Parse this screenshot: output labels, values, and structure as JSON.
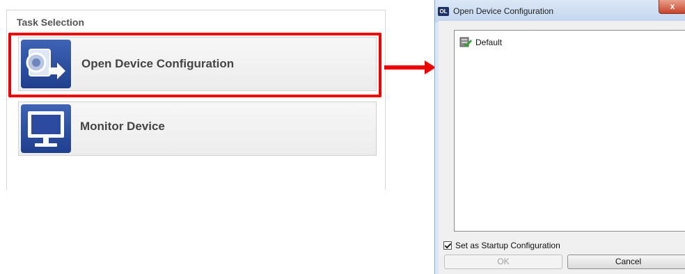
{
  "task_panel": {
    "title": "Task Selection",
    "items": [
      {
        "label": "Open Device Configuration",
        "icon": "device-config-icon"
      },
      {
        "label": "Monitor Device",
        "icon": "monitor-icon"
      }
    ]
  },
  "dialog": {
    "badge": "OL",
    "title": "Open Device Configuration",
    "close_label": "x",
    "list_items": [
      {
        "label": "Default",
        "icon": "configuration-icon"
      }
    ],
    "startup_label": "Set as Startup Configuration",
    "ok_label": "OK",
    "cancel_label": "Cancel"
  },
  "colors": {
    "highlight": "#ee0000",
    "icon_blue": "#2b4aa0"
  }
}
